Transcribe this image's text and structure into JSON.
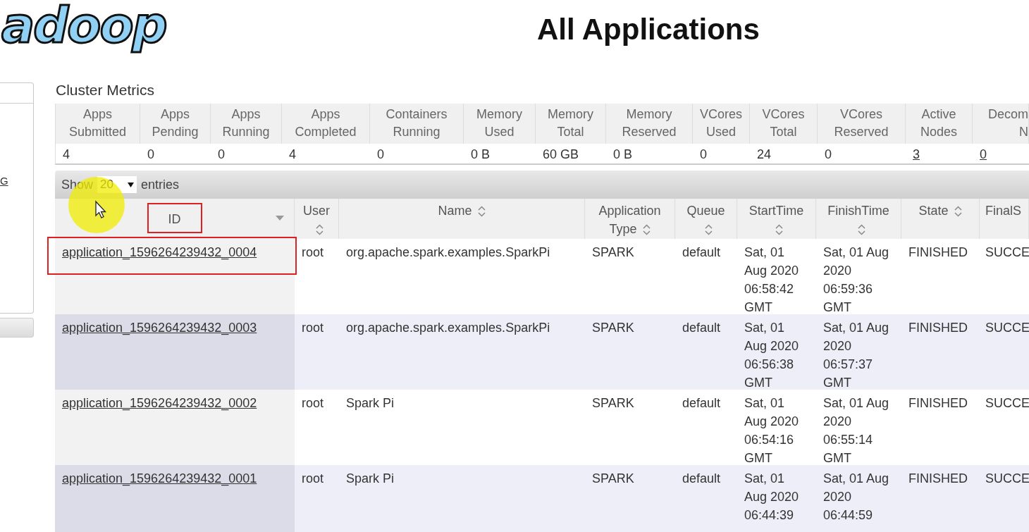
{
  "logo": {
    "text": "adoop"
  },
  "title": "All Applications",
  "sidebar": {
    "link": "G"
  },
  "cluster_metrics": {
    "title": "Cluster Metrics",
    "columns": [
      {
        "header": "Apps Submitted",
        "value": "4",
        "link": false
      },
      {
        "header": "Apps Pending",
        "value": "0",
        "link": false
      },
      {
        "header": "Apps Running",
        "value": "0",
        "link": false
      },
      {
        "header": "Apps Completed",
        "value": "4",
        "link": false
      },
      {
        "header": "Containers Running",
        "value": "0",
        "link": false
      },
      {
        "header": "Memory Used",
        "value": "0 B",
        "link": false
      },
      {
        "header": "Memory Total",
        "value": "60 GB",
        "link": false
      },
      {
        "header": "Memory Reserved",
        "value": "0 B",
        "link": false
      },
      {
        "header": "VCores Used",
        "value": "0",
        "link": false
      },
      {
        "header": "VCores Total",
        "value": "24",
        "link": false
      },
      {
        "header": "VCores Reserved",
        "value": "0",
        "link": false
      },
      {
        "header": "Active Nodes",
        "value": "3",
        "link": true
      },
      {
        "header": "Decom\nN",
        "value": "0",
        "link": true
      }
    ]
  },
  "table": {
    "length": {
      "before": "Show",
      "value": "20",
      "after": "entries"
    },
    "columns": [
      {
        "label": "ID",
        "sorted": true,
        "highlighted": true
      },
      {
        "label": "User",
        "sorted": false,
        "highlighted": false
      },
      {
        "label": "Name",
        "sorted": false,
        "highlighted": false
      },
      {
        "label": "Application Type",
        "sorted": false,
        "highlighted": false
      },
      {
        "label": "Queue",
        "sorted": false,
        "highlighted": false
      },
      {
        "label": "StartTime",
        "sorted": false,
        "highlighted": false
      },
      {
        "label": "FinishTime",
        "sorted": false,
        "highlighted": false
      },
      {
        "label": "State",
        "sorted": false,
        "highlighted": false
      },
      {
        "label": "FinalS",
        "highlighted": false
      }
    ],
    "rows": [
      {
        "highlighted": true,
        "cells": [
          "application_1596264239432_0004",
          "root",
          "org.apache.spark.examples.SparkPi",
          "SPARK",
          "default",
          "Sat, 01 Aug 2020 06:58:42 GMT",
          "Sat, 01 Aug 2020 06:59:36 GMT",
          "FINISHED",
          "SUCCE"
        ]
      },
      {
        "highlighted": false,
        "cells": [
          "application_1596264239432_0003",
          "root",
          "org.apache.spark.examples.SparkPi",
          "SPARK",
          "default",
          "Sat, 01 Aug 2020 06:56:38 GMT",
          "Sat, 01 Aug 2020 06:57:37 GMT",
          "FINISHED",
          "SUCCE"
        ]
      },
      {
        "highlighted": false,
        "cells": [
          "application_1596264239432_0002",
          "root",
          "Spark Pi",
          "SPARK",
          "default",
          "Sat, 01 Aug 2020 06:54:16 GMT",
          "Sat, 01 Aug 2020 06:55:14 GMT",
          "FINISHED",
          "SUCCE"
        ]
      },
      {
        "highlighted": false,
        "cells": [
          "application_1596264239432_0001",
          "root",
          "Spark Pi",
          "SPARK",
          "default",
          "Sat, 01 Aug 2020 06:44:39",
          "Sat, 01 Aug 2020 06:44:59",
          "FINISHED",
          "SUCCE"
        ]
      }
    ]
  }
}
